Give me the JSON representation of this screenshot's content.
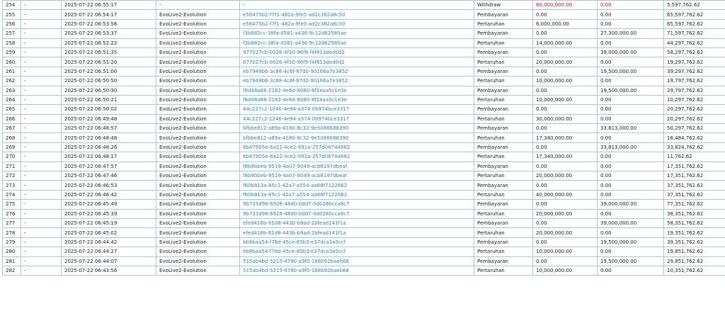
{
  "colors": {
    "link": "#2f86c6",
    "negative": "#e01010",
    "border": "#a9c6de",
    "text": "#222222"
  },
  "rows": [
    {
      "no": "254",
      "col2": "-",
      "time": "2025-07-22 06:55:17",
      "provider": "-",
      "ref": "-",
      "type": "Withdraw",
      "debit": "60,000,000.00",
      "credit": "0.00",
      "balance": "5,597,762.62",
      "red": true
    },
    {
      "no": "255",
      "col2": "-",
      "time": "2025-07-22 06:54:17",
      "provider": "EvoLive2-Evolution",
      "ref": "e56475b2-f7f1-482a-9fe5-ad2c382a8c50",
      "type": "Pembayaran",
      "debit": "0.00",
      "credit": "0.00",
      "balance": "65,597,762.62"
    },
    {
      "no": "256",
      "col2": "-",
      "time": "2025-07-22 06:53:56",
      "provider": "EvoLive2-Evolution",
      "ref": "e56475b2-f7f1-482a-9fe5-ad2c382a8c50",
      "type": "Pertaruhan",
      "debit": "6,000,000.00",
      "credit": "0.00",
      "balance": "65,597,762.62"
    },
    {
      "no": "257",
      "col2": "-",
      "time": "2025-07-22 06:53:37",
      "provider": "EvoLive2-Evolution",
      "ref": "f3b882cc-38fa-4581-a436-9c12d82580ae",
      "type": "Pembayaran",
      "debit": "0.00",
      "credit": "27,300,000.00",
      "balance": "71,597,762.62"
    },
    {
      "no": "258",
      "col2": "-",
      "time": "2025-07-22 06:52:22",
      "provider": "EvoLive2-Evolution",
      "ref": "f3b882cc-38fa-4581-a436-9c12d82580ae",
      "type": "Pertaruhan",
      "debit": "14,000,000.00",
      "credit": "0.00",
      "balance": "44,297,762.62"
    },
    {
      "no": "259",
      "col2": "-",
      "time": "2025-07-22 06:51:35",
      "provider": "EvoLive2-Evolution",
      "ref": "977027cb-0026-4f30-96f9-f4f813ded0d2",
      "type": "Pembayaran",
      "debit": "0.00",
      "credit": "39,000,000.00",
      "balance": "58,297,762.62"
    },
    {
      "no": "260",
      "col2": "-",
      "time": "2025-07-22 06:51:20",
      "provider": "EvoLive2-Evolution",
      "ref": "977027cb-0026-4f30-96f9-f4f813ded0d2",
      "type": "Pertaruhan",
      "debit": "20,000,000.00",
      "credit": "0.00",
      "balance": "19,297,762.62"
    },
    {
      "no": "261",
      "col2": "-",
      "time": "2025-07-22 06:51:00",
      "provider": "EvoLive2-Evolution",
      "ref": "eb7949b6-3c88-4c6f-87d0-90166a7e3852",
      "type": "Pembayaran",
      "debit": "0.00",
      "credit": "19,500,000.00",
      "balance": "39,297,762.62"
    },
    {
      "no": "262",
      "col2": "-",
      "time": "2025-07-22 06:50:50",
      "provider": "EvoLive2-Evolution",
      "ref": "eb7949b6-3c88-4c6f-87d0-90166a7e3852",
      "type": "Pertaruhan",
      "debit": "10,000,000.00",
      "credit": "0.00",
      "balance": "19,797,762.62"
    },
    {
      "no": "263",
      "col2": "-",
      "time": "2025-07-22 06:50:30",
      "provider": "EvoLive2-Evolution",
      "ref": "f8d48a88-2182-4e6d-8080-8f2eaa5c1e3e",
      "type": "Pembayaran",
      "debit": "0.00",
      "credit": "19,500,000.00",
      "balance": "29,797,762.62"
    },
    {
      "no": "264",
      "col2": "-",
      "time": "2025-07-22 06:50:21",
      "provider": "EvoLive2-Evolution",
      "ref": "f8d48a88-2182-4e6d-8080-8f2eaa5c1e3e",
      "type": "Pertaruhan",
      "debit": "10,000,000.00",
      "credit": "0.00",
      "balance": "10,297,762.62"
    },
    {
      "no": "265",
      "col2": "-",
      "time": "2025-07-22 06:50:02",
      "provider": "EvoLive2-Evolution",
      "ref": "44c227c2-1246-4e94-a374-0b974bce3317",
      "type": "Pembayaran",
      "debit": "0.00",
      "credit": "0.00",
      "balance": "20,297,762.62"
    },
    {
      "no": "266",
      "col2": "-",
      "time": "2025-07-22 06:49:48",
      "provider": "EvoLive2-Evolution",
      "ref": "44c227c2-1246-4e94-a374-0b974bce3317",
      "type": "Pertaruhan",
      "debit": "30,000,000.00",
      "credit": "0.00",
      "balance": "20,297,762.62"
    },
    {
      "no": "267",
      "col2": "-",
      "time": "2025-07-22 06:48:57",
      "provider": "EvoLive2-Evolution",
      "ref": "bfbbe812-a89a-4180-8c32-9e5086688390",
      "type": "Pembayaran",
      "debit": "0.00",
      "credit": "33,813,000.00",
      "balance": "50,297,762.62"
    },
    {
      "no": "268",
      "col2": "-",
      "time": "2025-07-22 06:48:46",
      "provider": "EvoLive2-Evolution",
      "ref": "bfbbe812-a89a-4180-8c32-9e5086688390",
      "type": "Pertaruhan",
      "debit": "17,340,000.00",
      "credit": "0.00",
      "balance": "16,484,762.62"
    },
    {
      "no": "269",
      "col2": "-",
      "time": "2025-07-22 06:48:26",
      "provider": "EvoLive2-Evolution",
      "ref": "6b47905e-6a22-4ce2-991a-257d06744682",
      "type": "Pembayaran",
      "debit": "0.00",
      "credit": "33,813,000.00",
      "balance": "33,824,762.62"
    },
    {
      "no": "270",
      "col2": "-",
      "time": "2025-07-22 06:48:17",
      "provider": "EvoLive2-Evolution",
      "ref": "6b47905e-6a22-4ce2-991a-257d06744682",
      "type": "Pertaruhan",
      "debit": "17,340,000.00",
      "credit": "0.00",
      "balance": "11,762.62"
    },
    {
      "no": "271",
      "col2": "-",
      "time": "2025-07-22 06:47:57",
      "provider": "EvoLive2-Evolution",
      "ref": "f8b9bbeb-9519-4a07-9049-acb8197dbeaf",
      "type": "Pembayaran",
      "debit": "0.00",
      "credit": "0.00",
      "balance": "17,351,762.62"
    },
    {
      "no": "272",
      "col2": "-",
      "time": "2025-07-22 06:47:46",
      "provider": "EvoLive2-Evolution",
      "ref": "f8b9bbeb-9519-4a07-9049-acb8197dbeaf",
      "type": "Pertaruhan",
      "debit": "20,000,000.00",
      "credit": "0.00",
      "balance": "17,351,762.62"
    },
    {
      "no": "273",
      "col2": "-",
      "time": "2025-07-22 06:46:53",
      "provider": "EvoLive2-Evolution",
      "ref": "f60b813a-85c1-42a7-a554-aa88f7122662",
      "type": "Pembayaran",
      "debit": "0.00",
      "credit": "0.00",
      "balance": "37,351,762.62"
    },
    {
      "no": "274",
      "col2": "-",
      "time": "2025-07-22 06:46:42",
      "provider": "EvoLive2-Evolution",
      "ref": "f60b813a-85c1-42a7-a554-aa88f7122662",
      "type": "Pertaruhan",
      "debit": "40,000,000.00",
      "credit": "0.00",
      "balance": "37,351,762.62"
    },
    {
      "no": "275",
      "col2": "-",
      "time": "2025-07-22 06:45:49",
      "provider": "EvoLive2-Evolution",
      "ref": "9b733d98-6926-48d0-bdd7-0d0280cca8c7",
      "type": "Pembayaran",
      "debit": "0.00",
      "credit": "39,000,000.00",
      "balance": "77,351,762.62"
    },
    {
      "no": "276",
      "col2": "-",
      "time": "2025-07-22 06:45:39",
      "provider": "EvoLive2-Evolution",
      "ref": "9b733d98-6926-48d0-bdd7-0d0280cca8c7",
      "type": "Pertaruhan",
      "debit": "20,000,000.00",
      "credit": "0.00",
      "balance": "38,351,762.62"
    },
    {
      "no": "277",
      "col2": "-",
      "time": "2025-07-22 06:45:19",
      "provider": "EvoLive2-Evolution",
      "ref": "efed416b-81d8-443b-b9ad-2bfead141f1a",
      "type": "Pembayaran",
      "debit": "0.00",
      "credit": "39,000,000.00",
      "balance": "58,351,762.62"
    },
    {
      "no": "278",
      "col2": "-",
      "time": "2025-07-22 06:45:02",
      "provider": "EvoLive2-Evolution",
      "ref": "efed416b-81d8-443b-b9ad-2bfead141f1a",
      "type": "Pertaruhan",
      "debit": "20,000,000.00",
      "credit": "0.00",
      "balance": "19,351,762.62"
    },
    {
      "no": "279",
      "col2": "-",
      "time": "2025-07-22 06:44:42",
      "provider": "EvoLive2-Evolution",
      "ref": "bb8baa54-f78d-45ce-85b3-e37dca3a5ccf",
      "type": "Pembayaran",
      "debit": "0.00",
      "credit": "19,500,000.00",
      "balance": "39,351,762.62"
    },
    {
      "no": "280",
      "col2": "-",
      "time": "2025-07-22 06:44:27",
      "provider": "EvoLive2-Evolution",
      "ref": "bb8baa54-f78d-45ce-85b3-e37dca3a5ccf",
      "type": "Pertaruhan",
      "debit": "10,000,000.00",
      "credit": "0.00",
      "balance": "19,851,762.62"
    },
    {
      "no": "281",
      "col2": "-",
      "time": "2025-07-22 06:44:07",
      "provider": "EvoLive2-Evolution",
      "ref": "515ab4bd-5215-4780-a9f0-188b92baeb68",
      "type": "Pembayaran",
      "debit": "0.00",
      "credit": "19,500,000.00",
      "balance": "29,851,762.62"
    },
    {
      "no": "282",
      "col2": "-",
      "time": "2025-07-22 06:43:56",
      "provider": "EvoLive2-Evolution",
      "ref": "515ab4bd-5215-4780-a9f0-188b92baeb68",
      "type": "Pertaruhan",
      "debit": "10,000,000.00",
      "credit": "0.00",
      "balance": "10,351,762.62"
    }
  ]
}
